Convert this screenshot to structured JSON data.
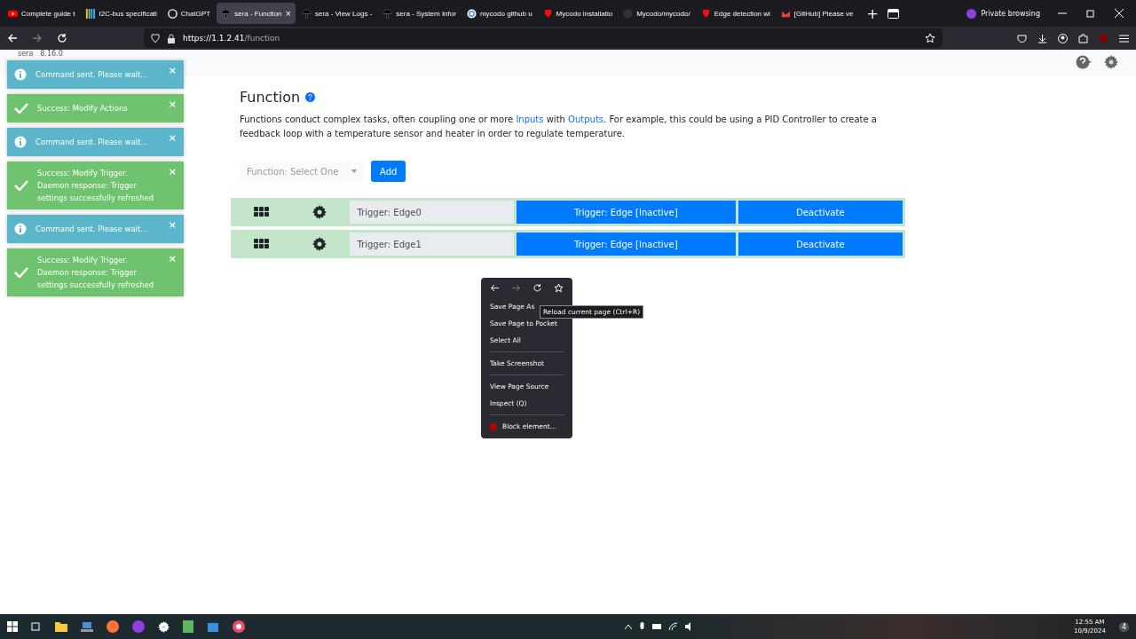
{
  "browser": {
    "tabs": [
      {
        "title": "Complete guide t",
        "kind": "play",
        "selected": false
      },
      {
        "title": "I2C-bus specificati",
        "kind": "bars",
        "selected": false
      },
      {
        "title": "ChatGPT",
        "kind": "knot",
        "selected": false
      },
      {
        "title": "sera - Function",
        "kind": "logo",
        "selected": true,
        "close": "×"
      },
      {
        "title": "sera - View Logs -",
        "kind": "logo",
        "selected": false
      },
      {
        "title": "sera - System Infor",
        "kind": "logo",
        "selected": false
      },
      {
        "title": "mycodo github u",
        "kind": "google",
        "selected": false
      },
      {
        "title": "Mycodo installatio",
        "kind": "shield",
        "selected": false
      },
      {
        "title": "Mycodo/mycodo/",
        "kind": "cat",
        "selected": false
      },
      {
        "title": "Edge detection wi",
        "kind": "shield",
        "selected": false
      },
      {
        "title": "[GitHub] Please ve",
        "kind": "mail",
        "selected": false
      }
    ],
    "new_tab": "+",
    "private": "Private browsing",
    "url_host": "https://1.1.2.41",
    "url_path": "/function"
  },
  "page": {
    "brand": "sera",
    "version": "8.16.0",
    "title": "Function",
    "description": [
      {
        "text": "Functions conduct complex tasks, often coupling one or more ",
        "link": false
      },
      {
        "text": "Inputs",
        "link": true
      },
      {
        "text": " with ",
        "link": false
      },
      {
        "text": "Outputs",
        "link": true
      },
      {
        "text": ". For example, this could be using a PID Controller to create a feedback loop with a temperature sensor and heater in order to regulate temperature.",
        "link": false
      }
    ],
    "select": {
      "placeholder": "Function: Select One"
    },
    "add_button": "Add",
    "rows": [
      {
        "name": "Trigger: Edge0",
        "status": "Trigger: Edge [Inactive]",
        "action": "Deactivate"
      },
      {
        "name": "Trigger: Edge1",
        "status": "Trigger: Edge [Inactive]",
        "action": "Deactivate"
      }
    ]
  },
  "toasts": [
    {
      "kind": "info",
      "text": "Command sent. Please wait...",
      "close": "×"
    },
    {
      "kind": "success",
      "text": "Success: Modify Actions",
      "close": "×"
    },
    {
      "kind": "info",
      "text": "Command sent. Please wait...",
      "close": "×"
    },
    {
      "kind": "success",
      "text": "Success: Modify Trigger. Daemon response: Trigger settings successfully refreshed",
      "close": "×"
    },
    {
      "kind": "info",
      "text": "Command sent. Please wait...",
      "close": "×"
    },
    {
      "kind": "success",
      "text": "Success: Modify Trigger. Daemon response: Trigger settings successfully refreshed",
      "close": "×"
    }
  ],
  "context_menu": {
    "items": [
      {
        "kind": "item",
        "label": "Save Page As"
      },
      {
        "kind": "item",
        "label": "Save Page to Pocket"
      },
      {
        "kind": "item",
        "label": "Select All"
      },
      {
        "kind": "separator"
      },
      {
        "kind": "item",
        "label": "Take Screenshot"
      },
      {
        "kind": "separator"
      },
      {
        "kind": "item",
        "label": "View Page Source"
      },
      {
        "kind": "item",
        "label": "Inspect (Q)"
      },
      {
        "kind": "separator"
      },
      {
        "kind": "addon",
        "label": "Block element..."
      }
    ],
    "tooltip": "Reload current page (Ctrl+R)"
  },
  "taskbar": {
    "time": "12:55 AM",
    "date": "10/9/2024",
    "notifications": "4"
  }
}
